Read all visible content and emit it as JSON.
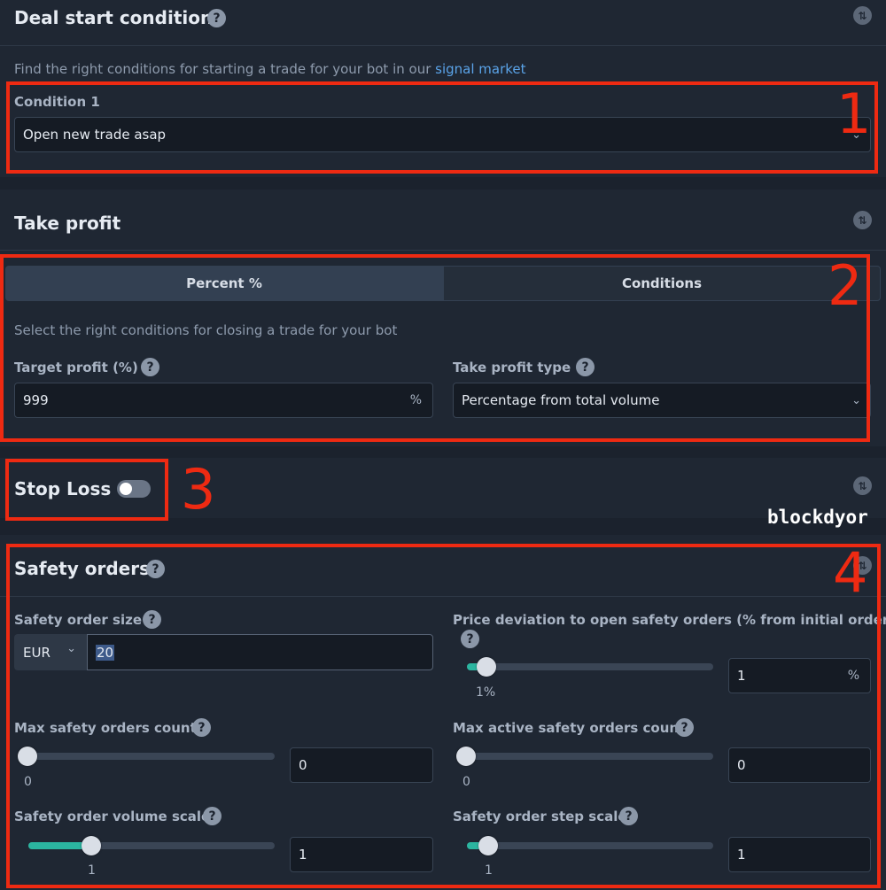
{
  "deal_start": {
    "title": "Deal start condition",
    "description_prefix": "Find the right conditions for starting a trade for your bot in our ",
    "description_link": "signal market",
    "condition_label": "Condition 1",
    "condition_value": "Open new trade asap"
  },
  "take_profit": {
    "title": "Take profit",
    "tabs": [
      "Percent %",
      "Conditions"
    ],
    "active_tab": "Percent %",
    "description": "Select the right conditions for closing a trade for your bot",
    "target_label": "Target profit (%)",
    "target_value": "999",
    "target_suffix": "%",
    "type_label": "Take profit type",
    "type_value": "Percentage from total volume"
  },
  "stop_loss": {
    "title": "Stop Loss",
    "enabled": false
  },
  "watermark": "blockdyor",
  "safety_orders": {
    "title": "Safety orders",
    "size_label": "Safety order size",
    "currency": "EUR",
    "size_value": "20",
    "deviation_label": "Price deviation to open safety orders (% from initial order)",
    "deviation_slider_label": "1%",
    "deviation_value": "1",
    "deviation_suffix": "%",
    "max_count_label": "Max safety orders count",
    "max_count_slider_label": "0",
    "max_count_value": "0",
    "max_active_label": "Max active safety orders count",
    "max_active_slider_label": "0",
    "max_active_value": "0",
    "volume_scale_label": "Safety order volume scale",
    "volume_scale_slider_label": "1",
    "volume_scale_value": "1",
    "step_scale_label": "Safety order step scale",
    "step_scale_slider_label": "1",
    "step_scale_value": "1"
  },
  "annotations": [
    "1",
    "2",
    "3",
    "4"
  ],
  "icons": {
    "help": "?",
    "swap": "⇅",
    "chevron": "⌄"
  },
  "colors": {
    "accent": "#2bb5a0",
    "annotation": "#ee2a12",
    "link": "#5aa3e8"
  }
}
